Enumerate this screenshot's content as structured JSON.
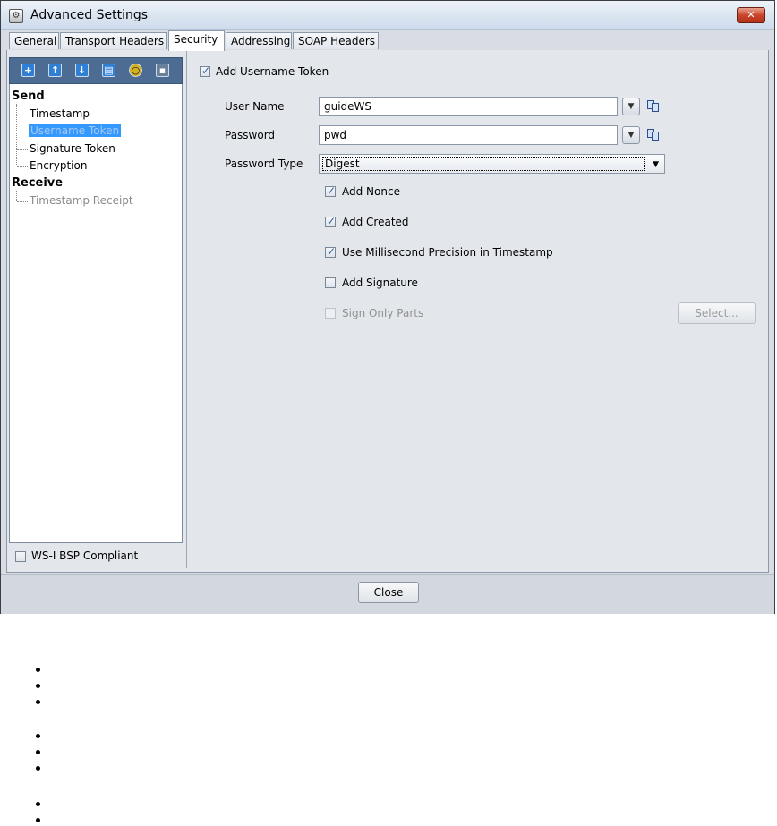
{
  "window": {
    "title": "Advanced Settings",
    "close_label": "✕"
  },
  "tabs": [
    {
      "label": "General"
    },
    {
      "label": "Transport Headers"
    },
    {
      "label": "Security"
    },
    {
      "label": "Addressing"
    },
    {
      "label": "SOAP Headers"
    }
  ],
  "toolbar": {
    "icons": [
      "add-icon",
      "move-up-icon",
      "move-down-icon",
      "delete-icon",
      "refresh-icon",
      "save-icon"
    ]
  },
  "tree": {
    "send_label": "Send",
    "send_items": [
      "Timestamp",
      "Username Token",
      "Signature Token",
      "Encryption"
    ],
    "receive_label": "Receive",
    "receive_items": [
      "Timestamp Receipt"
    ]
  },
  "wsi": {
    "label": "WS-I BSP Compliant",
    "checked": false
  },
  "form": {
    "add_username_token": "Add Username Token",
    "user_name_label": "User Name",
    "user_name_value": "guideWS",
    "password_label": "Password",
    "password_value": "pwd",
    "password_type_label": "Password Type",
    "password_type_value": "Digest",
    "add_nonce": "Add Nonce",
    "add_created": "Add Created",
    "use_ms_precision": "Use Millisecond Precision in Timestamp",
    "add_signature": "Add Signature",
    "sign_only_parts": "Sign Only Parts",
    "select_button": "Select..."
  },
  "footer": {
    "close_button": "Close"
  },
  "colors": {
    "selection": "#3399ff",
    "toolbar": "#4c6c94",
    "titlebar": "#dce6f1"
  }
}
